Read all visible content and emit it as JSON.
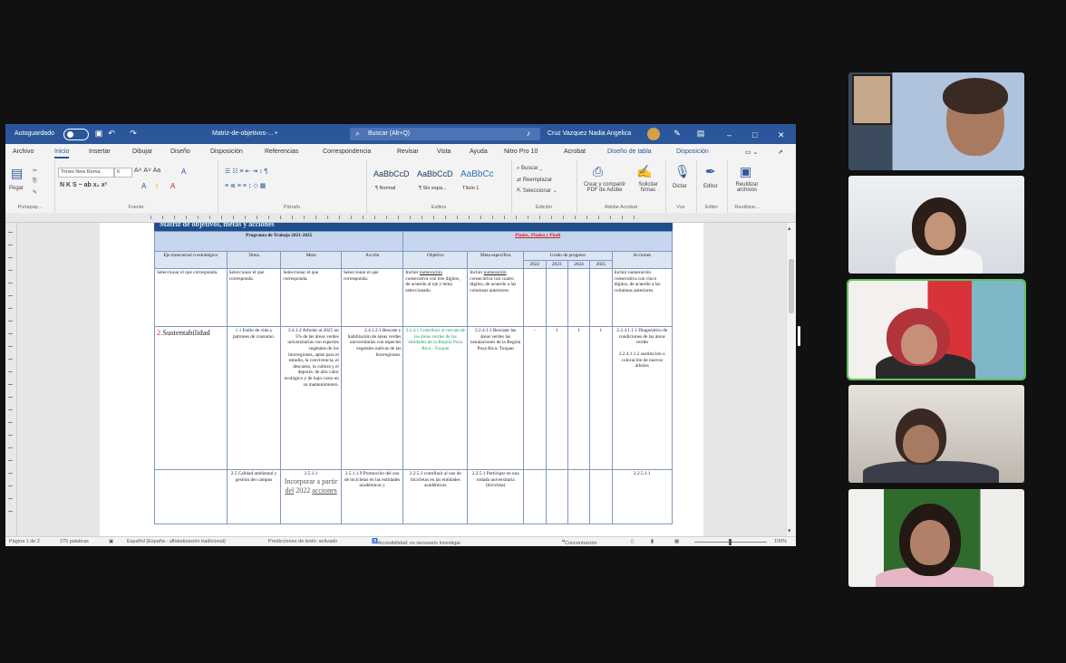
{
  "word": {
    "autosave_label": "Autoguardado",
    "doc_title": "Matriz-de-objetivos-... •",
    "search_placeholder": "Buscar (Alt+Q)",
    "user_name": "Cruz Vazquez Nadia Angelica",
    "menu": [
      "Archivo",
      "Inicio",
      "Insertar",
      "Dibujar",
      "Diseño",
      "Disposición",
      "Referencias",
      "Correspondencia",
      "Revisar",
      "Vista",
      "Ayuda",
      "Nitro Pro 10",
      "Acrobat",
      "Diseño de tabla",
      "Disposición"
    ],
    "ribbon": {
      "paste": "Pegar",
      "clipboard": "Portapap...",
      "font_name": "Times New Roma",
      "font_size": "6",
      "font_group": "Fuente",
      "paragraph_group": "Párrafo",
      "styles": [
        {
          "preview": "AaBbCcD",
          "name": "¶ Normal"
        },
        {
          "preview": "AaBbCcD",
          "name": "¶ Sin espa..."
        },
        {
          "preview": "AaBbCc",
          "name": "Título 1"
        }
      ],
      "styles_group": "Estilos",
      "find": "Buscar",
      "replace": "Reemplazar",
      "select": "Seleccionar",
      "edit_group": "Edición",
      "create_pdf": "Crear y compartir PDF de Adobe",
      "request_sign": "Solicitar firmas",
      "adobe_group": "Adobe Acrobat",
      "dictate": "Dictar",
      "voice_group": "Voz",
      "editor": "Editor",
      "editor_group": "Editor",
      "reuse": "Reutilizar archivos",
      "reuse_group": "Reutilizar..."
    },
    "status": {
      "page": "Página 1 de 2",
      "words": "275 palabras",
      "lang": "Español (España - alfabetización tradicional)",
      "predictions": "Predicciones de texto: activado",
      "accessibility": "Accesibilidad: es necesario investigar",
      "focus": "Concentración",
      "zoom": "100%"
    },
    "document": {
      "title": "Matriz de objetivos, metas y acciones",
      "program_header": "Programa de Trabajo 2021-2025",
      "plan_header": "Pladec, Pladea y Pladi",
      "cols": [
        "Eje transversal o estratégico",
        "Tema",
        "Meta",
        "Acción",
        "Objetivo",
        "Meta específica",
        "Grado de progreso",
        "Acciones"
      ],
      "years": [
        "2022",
        "2023",
        "2024",
        "2025"
      ],
      "row1": {
        "eje": "Seleccionar el que corresponda.",
        "tema": "Seleccionar el que corresponda.",
        "meta": "Seleccionar el que corresponda.",
        "accion": "Seleccionar el que corresponda.",
        "objetivo_a": "Incluir ",
        "objetivo_ul": "numeración",
        "objetivo_b": " consecutiva con tres dígitos, de acuerdo al eje y tema seleccionado.",
        "meta_esp_a": "Incluir ",
        "meta_esp_ul": "numeración",
        "meta_esp_b": " consecutiva con cuatro dígitos, de acuerdo a las columnas anteriores.",
        "acciones": "Incluir numeración consecutiva con cinco dígitos, de acuerdo a las columnas anteriores."
      },
      "row2": {
        "eje_num": "2.",
        "eje_text": "Sustentabilidad",
        "tema_num": "2.4",
        "tema_text": " Estilo de vida y patrones de consumo.",
        "meta": "2.4.1.2 Arbolar al 2025 un 5% de las áreas verdes universitarias con especies vegetales de los biorregiones, aptas para el estudio, la convivencia, el descanso, la cultura y el deporte, de alto valor ecológico y de bajo costo en su mantenimiento.",
        "accion": "2.4.1.2.1 Rescate y habilitación de áreas verdes universitarias con especies vegetales nativas de las biorregiones.",
        "objetivo": "2.2.4.1 Contribuir al rescate de las áreas verdes de las entidades de la Región Poza Rica - Tuxpan",
        "meta_esp": "2.2.4.1.1 Rescatar las áreas verdes las instalaciones de la Región Poza Rica- Tuxpan",
        "p2022": "-",
        "p2023": "1",
        "p2024": "1",
        "p2025": "1",
        "acciones_a": "2.2.4.1.1.1 Diagnóstico de condiciones de las áreas verdes",
        "acciones_b": "2.2.4.1.1.2 sustitución o colocación de nuevos árboles"
      },
      "row3": {
        "tema": "2.5 Calidad ambiental y gestión del campus",
        "meta_num": "2.5.1.1",
        "meta_a": "Incorporar a partir ",
        "meta_ul1": "del",
        "meta_b": " 2022 ",
        "meta_ul2": "acciones",
        "accion": "2.5.1.1.9 Promoción del uso de bicicletas en las entidades académicas y",
        "objetivo": "2.2.5.1 contribuir al uso de bicicletas en las entidades académicas",
        "meta_esp": "2.2.5.1 Participar en una rodada universitaria (bicicleta)",
        "acciones": "2.2.5.1.1"
      }
    }
  },
  "colors": {
    "word_blue": "#2b579a",
    "table_border": "#7f98c2",
    "header_fill": "#c5d6ee",
    "active_speaker": "#5cc45a"
  }
}
